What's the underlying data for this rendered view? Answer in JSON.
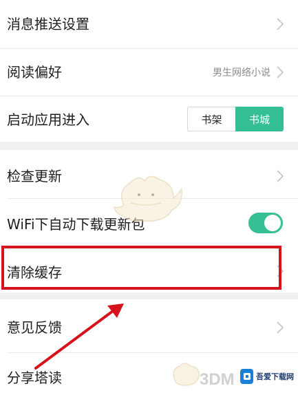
{
  "settings": {
    "push": {
      "label": "消息推送设置"
    },
    "reading": {
      "label": "阅读偏好",
      "value": "男生网络小说"
    },
    "startup": {
      "label": "启动应用进入",
      "options": [
        "书架",
        "书城"
      ],
      "selected": "书城"
    },
    "update": {
      "label": "检查更新"
    },
    "wifi": {
      "label": "WiFi下自动下载更新包",
      "enabled": true
    },
    "cache": {
      "label": "清除缓存"
    },
    "feedback": {
      "label": "意见反馈"
    },
    "share": {
      "label": "分享塔读"
    }
  },
  "watermark": {
    "brand": "3DM",
    "site": "吾爱下载网"
  },
  "colors": {
    "accent": "#35bf94",
    "highlight": "#d6131c",
    "arrow": "#d6131c"
  }
}
